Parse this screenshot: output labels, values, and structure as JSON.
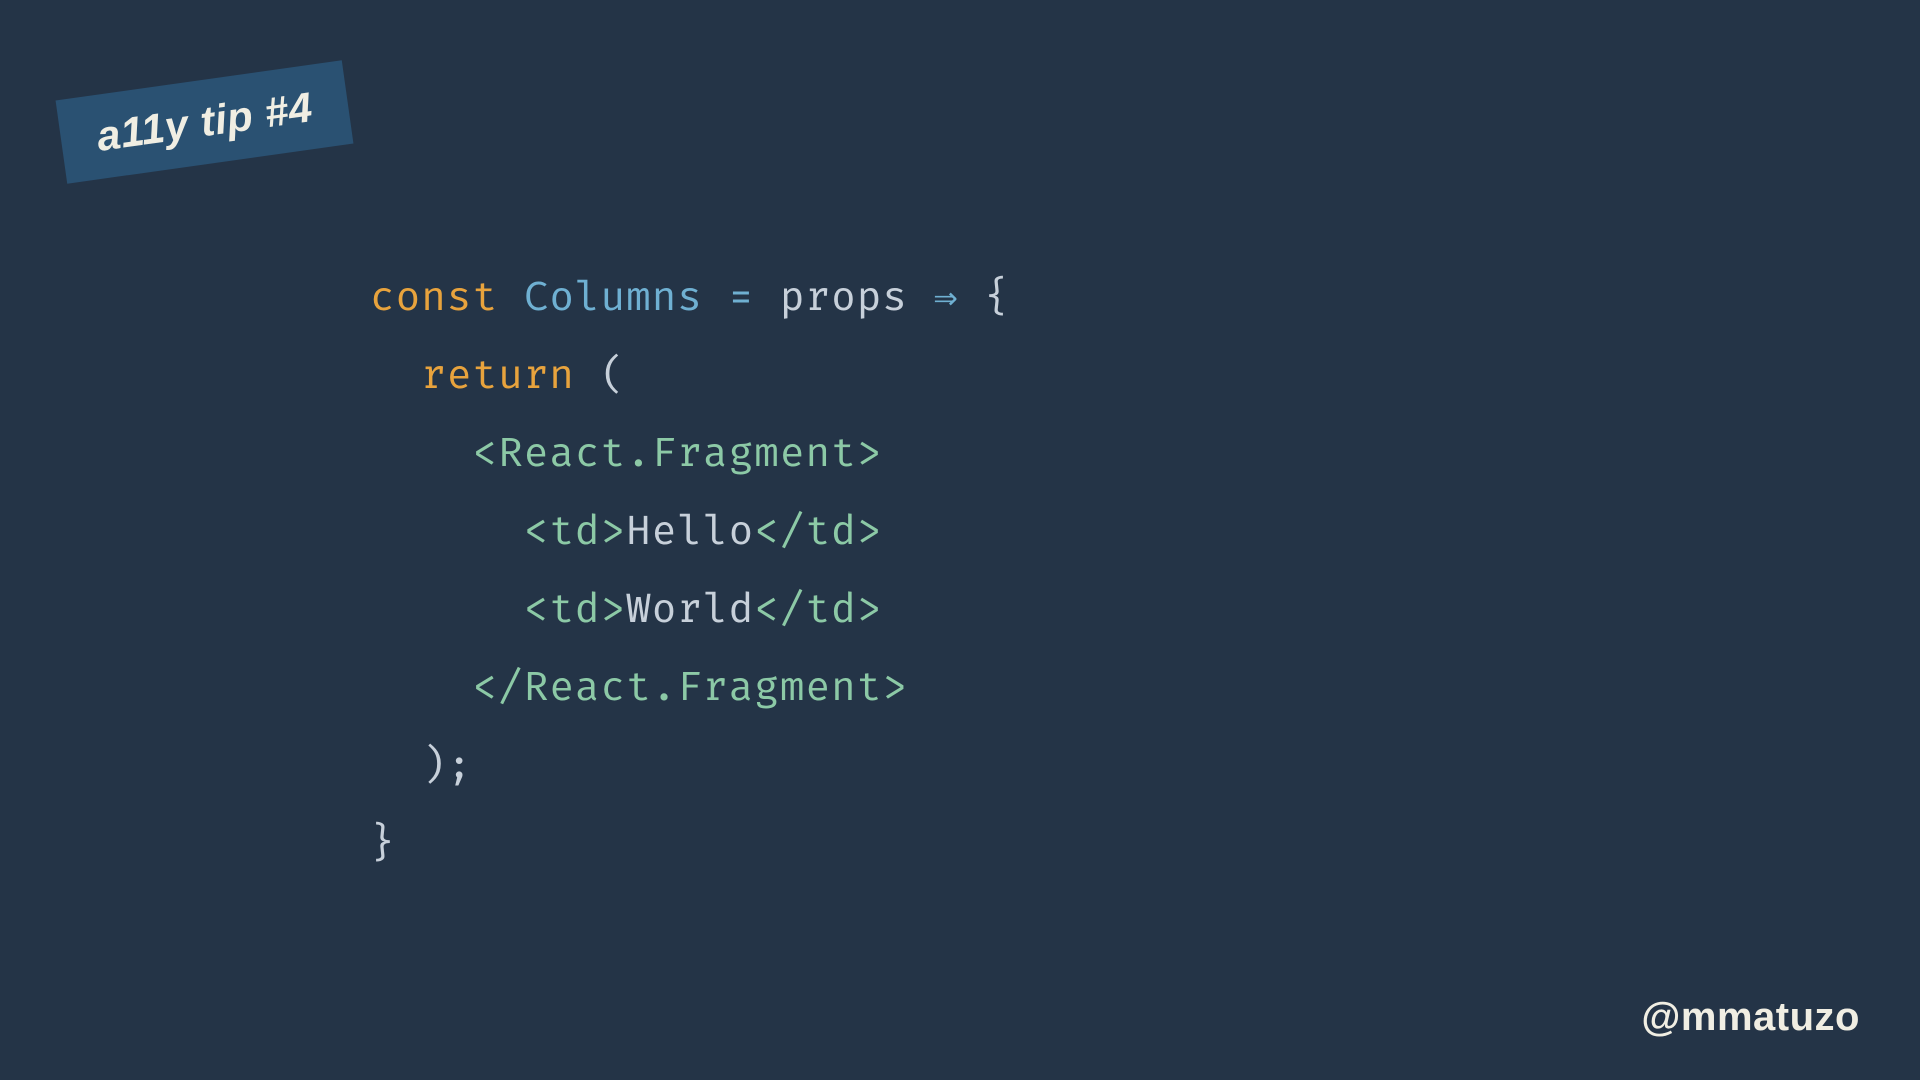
{
  "badge": {
    "label": "a11y tip #4"
  },
  "handle": {
    "text": "@mmatuzo"
  },
  "code": {
    "kw_const": "const",
    "fn_name": "Columns",
    "eq": "=",
    "props": "props",
    "arrow": "⇒",
    "brace_open": "{",
    "kw_return": "return",
    "paren_open": "(",
    "frag_open": "<React.Fragment>",
    "td_open": "<td>",
    "hello": "Hello",
    "td_close": "</td>",
    "world": "World",
    "frag_close": "</React.Fragment>",
    "paren_close_semi": ");",
    "brace_close": "}"
  }
}
